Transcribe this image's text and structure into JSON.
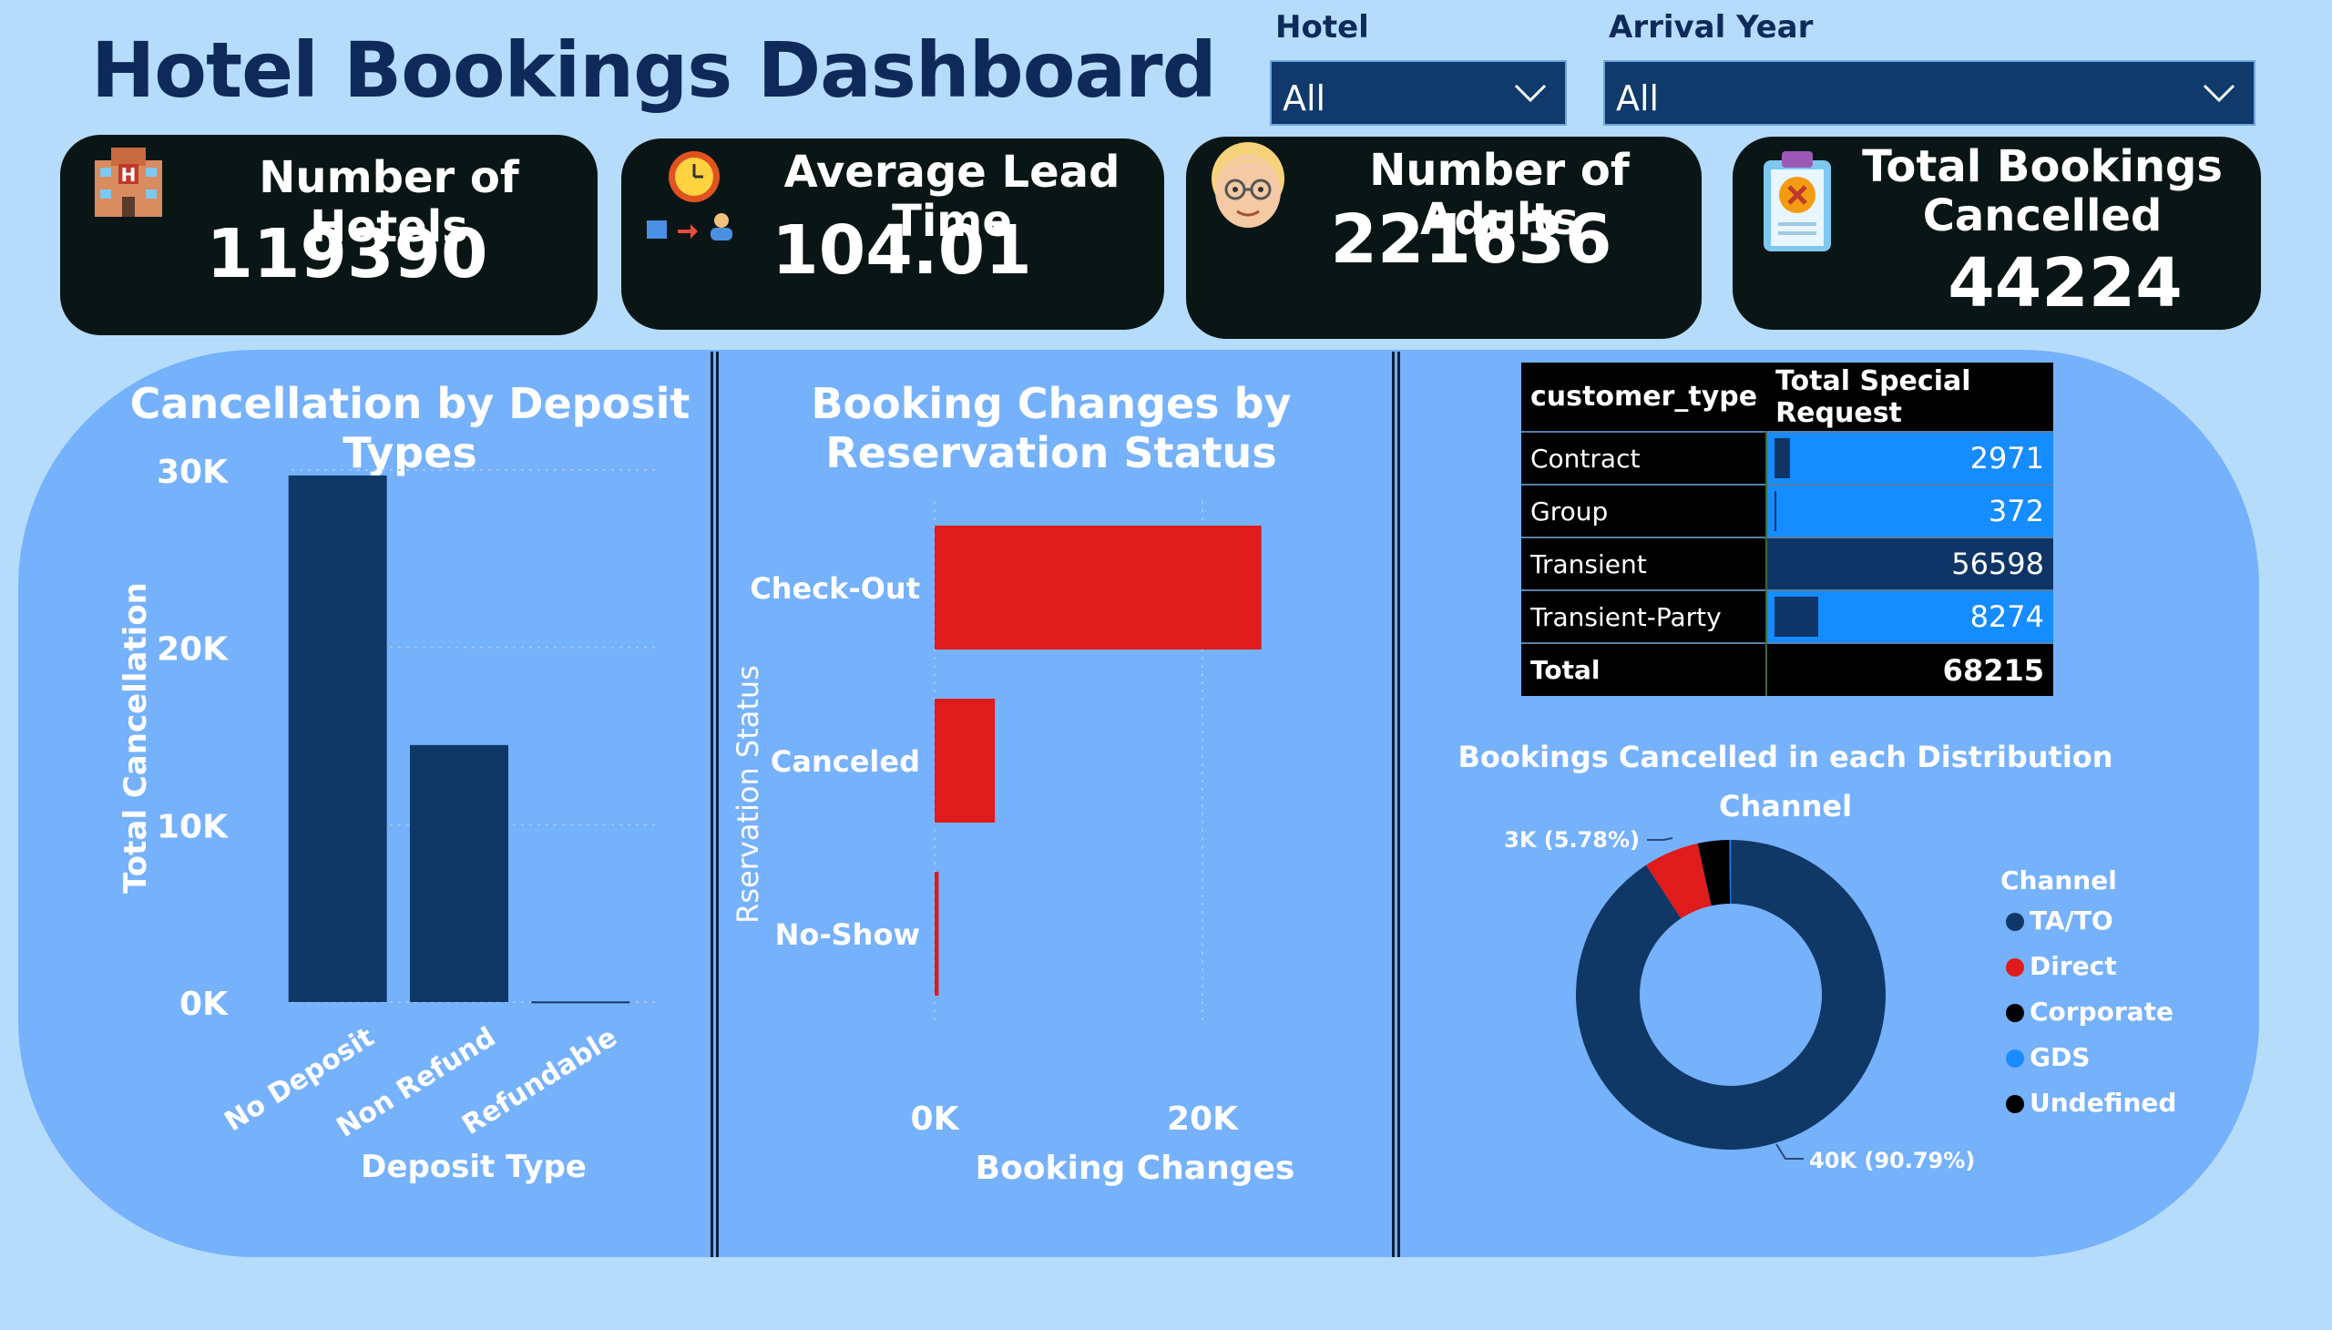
{
  "header": {
    "title": "Hotel Bookings Dashboard"
  },
  "filters": [
    {
      "label": "Hotel",
      "value": "All"
    },
    {
      "label": "Arrival Year",
      "value": "All"
    }
  ],
  "kpis": [
    {
      "label": "Number of Hotels",
      "value": "119390",
      "icon": "hotel-icon"
    },
    {
      "label": "Average Lead Time",
      "value": "104.01",
      "icon": "clock-icon"
    },
    {
      "label": "Number of Adults",
      "value": "221636",
      "icon": "adult-face-icon"
    },
    {
      "label_line1": "Total Bookings",
      "label_line2": "Cancelled",
      "value": "44224",
      "icon": "cancel-clipboard-icon"
    }
  ],
  "chart_data": [
    {
      "type": "bar",
      "title": "Cancellation by Deposit Types",
      "categories": [
        "No Deposit",
        "Non Refund",
        "Refundable"
      ],
      "values": [
        29694,
        14494,
        36
      ],
      "xlabel": "Deposit Type",
      "ylabel": "Total Cancellation",
      "ylim": [
        0,
        30000
      ],
      "yticks": [
        "0K",
        "10K",
        "20K",
        "30K"
      ],
      "ytick_values": [
        0,
        10000,
        20000,
        30000
      ],
      "color": "#103866",
      "grid": true
    },
    {
      "type": "bar",
      "orientation": "horizontal",
      "title": "Booking Changes by Reservation Status",
      "categories": [
        "Check-Out",
        "Canceled",
        "No-Show"
      ],
      "values": [
        24400,
        4500,
        300
      ],
      "xlabel": "Booking Changes",
      "ylabel": "Rservation Status",
      "xlim": [
        0,
        24400
      ],
      "xticks": [
        "0K",
        "20K"
      ],
      "xtick_values": [
        0,
        20000
      ],
      "color": "#e01b1b",
      "grid": true
    },
    {
      "type": "table",
      "columns": [
        "customer_type",
        "Total Special Request"
      ],
      "rows": [
        {
          "customer_type": "Contract",
          "value": 2971
        },
        {
          "customer_type": "Group",
          "value": 372
        },
        {
          "customer_type": "Transient",
          "value": 56598
        },
        {
          "customer_type": "Transient-Party",
          "value": 8274
        }
      ],
      "total_label": "Total",
      "total_value": 68215
    },
    {
      "type": "pie",
      "title": "Bookings Cancelled in each Distribution Channel",
      "legend_title": "Channel",
      "legend_position": "right",
      "slices": [
        {
          "name": "TA/TO",
          "value": 40152,
          "percent": 90.79,
          "color": "#103866",
          "label": "40K (90.79%)"
        },
        {
          "name": "Direct",
          "value": 2557,
          "percent": 5.78,
          "color": "#e01b1b",
          "label": "3K (5.78%)"
        },
        {
          "name": "Corporate",
          "value": 1451,
          "percent": 3.28,
          "color": "#000000",
          "label": ""
        },
        {
          "name": "GDS",
          "value": 60,
          "percent": 0.14,
          "color": "#1a8cff",
          "label": ""
        },
        {
          "name": "Undefined",
          "value": 4,
          "percent": 0.01,
          "color": "#000000",
          "label": ""
        }
      ]
    }
  ]
}
